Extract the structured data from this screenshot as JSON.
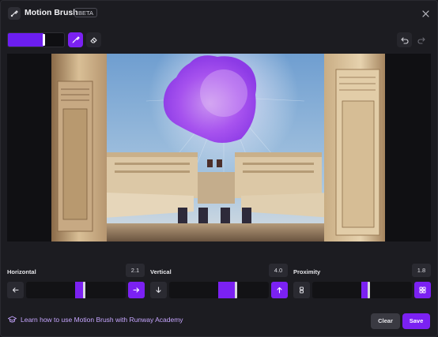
{
  "header": {
    "title": "Motion Brush",
    "badge": "BETA"
  },
  "toolbar": {
    "brush_color": "#6c1ef0"
  },
  "sliders": [
    {
      "label": "Horizontal",
      "value": "2.1",
      "fill_fraction": 0.5,
      "left_icon": "arrow-left-icon",
      "right_icon": "arrow-right-icon"
    },
    {
      "label": "Vertical",
      "value": "4.0",
      "fill_fraction": 0.5,
      "left_icon": "arrow-down-icon",
      "right_icon": "arrow-up-icon"
    },
    {
      "label": "Proximity",
      "value": "1.8",
      "fill_fraction": 0.5,
      "left_icon": "proximity-near-icon",
      "right_icon": "proximity-far-icon"
    }
  ],
  "footer": {
    "academy_link": "Learn how to use Motion Brush with Runway Academy",
    "clear_label": "Clear",
    "save_label": "Save"
  },
  "colors": {
    "accent": "#7b21f2",
    "link": "#c6a6ff",
    "background": "#1c1c21"
  }
}
